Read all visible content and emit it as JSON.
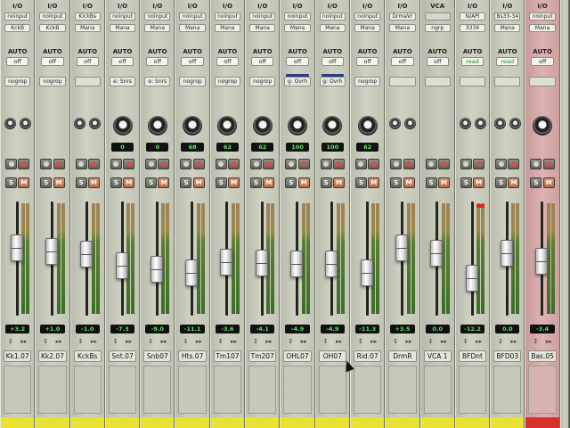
{
  "labels": {
    "io": "I/O",
    "auto": "AUTO",
    "vca": "VCA"
  },
  "channels": [
    {
      "name": "Kk1.07",
      "input": "noinput",
      "output": "KckB",
      "auto": "off",
      "group": "nogrop",
      "control": "small",
      "pan": "",
      "volume": "+3.2",
      "fader": 0.62
    },
    {
      "name": "Kk2.07",
      "input": "noinput",
      "output": "KckB",
      "auto": "off",
      "group": "nogrop",
      "control": "none",
      "pan": "",
      "volume": "+1.0",
      "fader": 0.58
    },
    {
      "name": "KckBs",
      "input": "KickBs",
      "output": "Mana",
      "auto": "off",
      "group": "",
      "control": "small",
      "pan": "",
      "volume": "-1.0",
      "fader": 0.55
    },
    {
      "name": "Snt.07",
      "input": "noinput",
      "output": "Mana",
      "auto": "off",
      "group": "e: Snrs",
      "control": "big",
      "pan": "0",
      "volume": "-7.3",
      "fader": 0.42
    },
    {
      "name": "Snb07",
      "input": "noinput",
      "output": "Mana",
      "auto": "off",
      "group": "e: Snrs",
      "control": "big",
      "pan": "0",
      "volume": "-9.0",
      "fader": 0.38
    },
    {
      "name": "Hts.07",
      "input": "noinput",
      "output": "Mana",
      "auto": "off",
      "group": "nogrop",
      "control": "big",
      "pan": "68",
      "volume": "-11.1",
      "fader": 0.34
    },
    {
      "name": "Tm107",
      "input": "noinput",
      "output": "Mana",
      "auto": "off",
      "group": "nogrop",
      "control": "big",
      "pan": "62",
      "volume": "-3.6",
      "fader": 0.46
    },
    {
      "name": "Tm207",
      "input": "noinput",
      "output": "Mana",
      "auto": "off",
      "group": "nogrop",
      "control": "big",
      "pan": "62",
      "volume": "-4.1",
      "fader": 0.45
    },
    {
      "name": "OHL07",
      "input": "noinput",
      "output": "Mana",
      "auto": "off",
      "group": "g: Ovrh",
      "control": "big",
      "pan": "100",
      "volume": "-4.9",
      "fader": 0.44
    },
    {
      "name": "OH07",
      "input": "noinput",
      "output": "Mana",
      "auto": "off",
      "group": "g: Ovrh",
      "control": "big",
      "pan": "100",
      "volume": "-4.9",
      "fader": 0.44
    },
    {
      "name": "Rid.07",
      "input": "noinput",
      "output": "Mana",
      "auto": "off",
      "group": "nogrop",
      "control": "big",
      "pan": "62",
      "volume": "-11.3",
      "fader": 0.34
    },
    {
      "name": "DrmR",
      "input": "DrmaVr",
      "output": "Mana",
      "auto": "off",
      "group": "",
      "control": "small",
      "pan": "",
      "volume": "+3.5",
      "fader": 0.62
    },
    {
      "name": "VCA 1",
      "input": "",
      "output": "ngrp",
      "auto": "off",
      "group": "",
      "control": "none",
      "pan": "",
      "volume": "0.0",
      "fader": 0.56,
      "vca": true
    },
    {
      "name": "BFDnt",
      "input": "N/APi",
      "output": "3334",
      "auto": "read",
      "group": "",
      "control": "small",
      "pan": "",
      "volume": "-12.2",
      "fader": 0.28,
      "clip": true
    },
    {
      "name": "BFD03",
      "input": "Bs33-34",
      "output": "Mana",
      "auto": "read",
      "group": "",
      "control": "small",
      "pan": "",
      "volume": "0.0",
      "fader": 0.56
    },
    {
      "name": "Bas.05",
      "input": "noinput",
      "output": "Mana",
      "auto": "off",
      "group": "",
      "control": "big",
      "pan": "",
      "volume": "-3.4",
      "fader": 0.47,
      "selected": true
    }
  ],
  "buttons": {
    "solo": "S",
    "mute": "M"
  }
}
